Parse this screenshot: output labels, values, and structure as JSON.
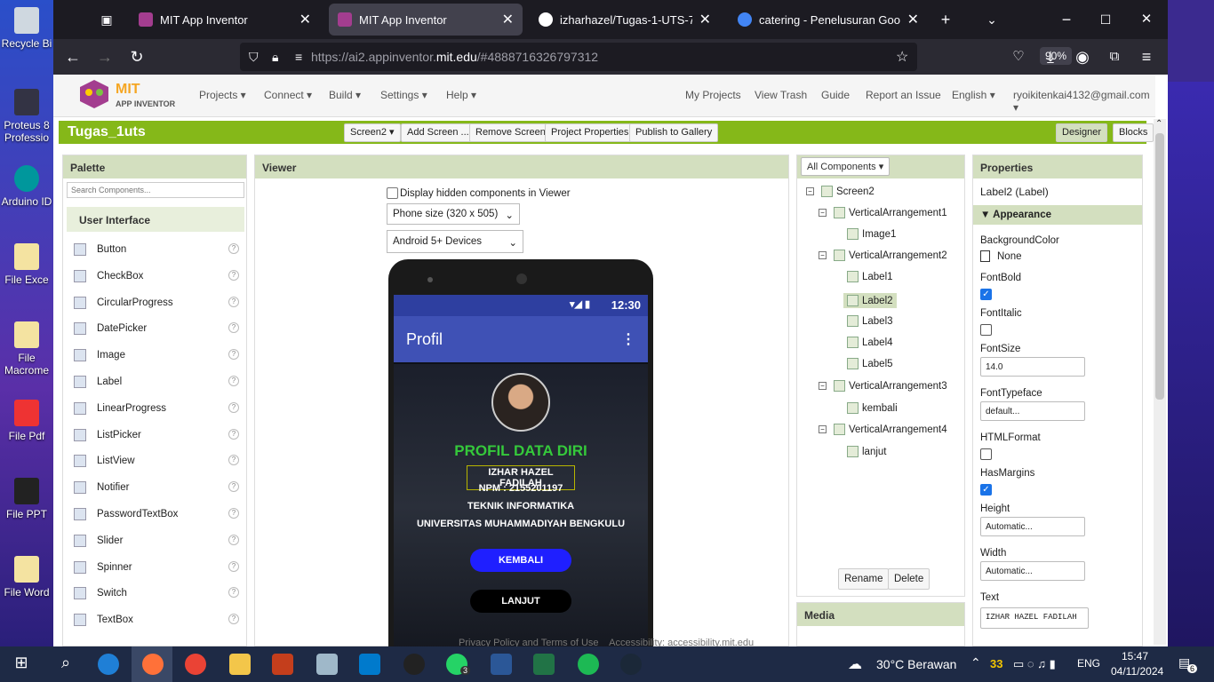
{
  "desktop": {
    "icons": [
      {
        "label": "Recycle Bi"
      },
      {
        "label": "Proteus 8 Professio"
      },
      {
        "label": "Arduino ID"
      },
      {
        "label": "File Exce"
      },
      {
        "label": "File Macrome"
      },
      {
        "label": "File Pdf"
      },
      {
        "label": "File PPT"
      },
      {
        "label": "File Word"
      }
    ]
  },
  "browser": {
    "tabs": [
      {
        "title": "MIT App Inventor",
        "icon": "app-inventor-icon",
        "active": false
      },
      {
        "title": "MIT App Inventor",
        "icon": "app-inventor-icon",
        "active": true
      },
      {
        "title": "izharhazel/Tugas-1-UTS-7.3",
        "icon": "github-icon",
        "active": false
      },
      {
        "title": "catering - Penelusuran Google",
        "icon": "google-icon",
        "active": false
      }
    ],
    "url_prefix": "https://ai2.appinventor.",
    "url_domain": "mit.edu",
    "url_suffix": "/#4888716326797312",
    "zoom": "90%"
  },
  "appinventor": {
    "logo_top": "MIT",
    "logo_bottom": "APP INVENTOR",
    "menu_left": [
      "Projects ▾",
      "Connect ▾",
      "Build ▾",
      "Settings ▾",
      "Help ▾"
    ],
    "menu_right": [
      "My Projects",
      "View Trash",
      "Guide",
      "Report an Issue",
      "English ▾",
      "ryoikitenkai4132@gmail.com ▾"
    ],
    "project_name": "Tugas_1uts",
    "toolbar": [
      "Screen2 ▾",
      "Add Screen ...",
      "Remove Screen",
      "Project Properties",
      "Publish to Gallery"
    ],
    "designer_label": "Designer",
    "blocks_label": "Blocks",
    "palette": {
      "title": "Palette",
      "search_placeholder": "Search Components...",
      "category": "User Interface",
      "items": [
        "Button",
        "CheckBox",
        "CircularProgress",
        "DatePicker",
        "Image",
        "Label",
        "LinearProgress",
        "ListPicker",
        "ListView",
        "Notifier",
        "PasswordTextBox",
        "Slider",
        "Spinner",
        "Switch",
        "TextBox"
      ]
    },
    "viewer": {
      "title": "Viewer",
      "hidden_label": "Display hidden components in Viewer",
      "size_select": "Phone size (320 x 505)",
      "device_select": "Android 5+ Devices",
      "time": "12:30",
      "screen_title": "Profil",
      "heading": "PROFIL DATA DIRI",
      "name": "IZHAR HAZEL FADILAH",
      "npm": "NPM : 2155201197",
      "major": "TEKNIK INFORMATIKA",
      "university": "UNIVERSITAS MUHAMMADIYAH BENGKULU",
      "btn_back": "KEMBALI",
      "btn_next": "LANJUT"
    },
    "components": {
      "dropdown": "All Components ▾",
      "tree": [
        {
          "label": "Screen2",
          "level": 0,
          "toggle": "⊟"
        },
        {
          "label": "VerticalArrangement1",
          "level": 1,
          "toggle": "⊟"
        },
        {
          "label": "Image1",
          "level": 2,
          "toggle": ""
        },
        {
          "label": "VerticalArrangement2",
          "level": 1,
          "toggle": "⊟"
        },
        {
          "label": "Label1",
          "level": 2,
          "toggle": ""
        },
        {
          "label": "Label2",
          "level": 2,
          "toggle": "",
          "selected": true
        },
        {
          "label": "Label3",
          "level": 2,
          "toggle": ""
        },
        {
          "label": "Label4",
          "level": 2,
          "toggle": ""
        },
        {
          "label": "Label5",
          "level": 2,
          "toggle": ""
        },
        {
          "label": "VerticalArrangement3",
          "level": 1,
          "toggle": "⊟"
        },
        {
          "label": "kembali",
          "level": 2,
          "toggle": ""
        },
        {
          "label": "VerticalArrangement4",
          "level": 1,
          "toggle": "⊟"
        },
        {
          "label": "lanjut",
          "level": 2,
          "toggle": ""
        }
      ],
      "rename": "Rename",
      "delete": "Delete",
      "media": "Media"
    },
    "properties": {
      "title": "Properties",
      "component": "Label2 (Label)",
      "section": "Appearance",
      "bg_label": "BackgroundColor",
      "bg_value": "None",
      "fontbold_label": "FontBold",
      "fontitalic_label": "FontItalic",
      "fontsize_label": "FontSize",
      "fontsize_value": "14.0",
      "typeface_label": "FontTypeface",
      "typeface_value": "default...",
      "html_label": "HTMLFormat",
      "margins_label": "HasMargins",
      "height_label": "Height",
      "height_value": "Automatic...",
      "width_label": "Width",
      "width_value": "Automatic...",
      "text_label": "Text",
      "text_value": "IZHAR HAZEL FADILAH"
    },
    "footer": "Privacy Policy and Terms of Use    Accessibility: accessibility.mit.edu"
  },
  "taskbar": {
    "weather": "30°C  Berawan",
    "badge": "33",
    "lang": "ENG",
    "time": "15:47",
    "date": "04/11/2024",
    "notif": "6",
    "whatsapp_count": "3"
  },
  "colors": {
    "ai_green": "#85b819",
    "header_blue": "#3f51b5",
    "btn_blue": "#1f1fff"
  }
}
